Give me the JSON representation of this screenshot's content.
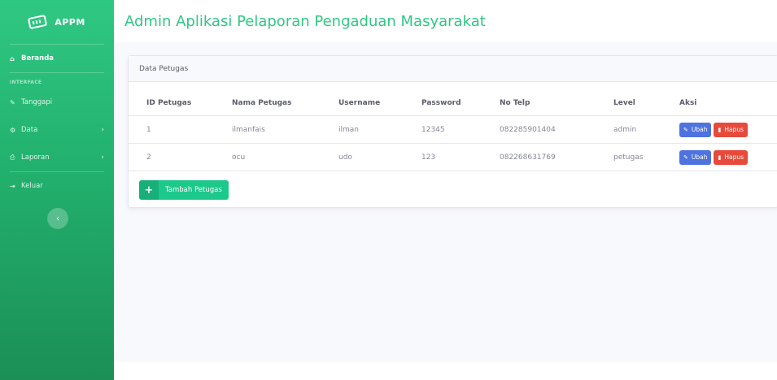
{
  "app": {
    "brand": "APPM",
    "page_title": "Admin Aplikasi Pelaporan Pengaduan Masyarakat",
    "accent_color": "#2fc883"
  },
  "sidebar": {
    "items": [
      {
        "label": "Beranda",
        "icon": "home-icon",
        "active": true
      },
      {
        "label": "Tanggapi",
        "icon": "edit-icon"
      },
      {
        "label": "Data",
        "icon": "gear-icon",
        "has_submenu": true
      },
      {
        "label": "Laporan",
        "icon": "print-icon",
        "has_submenu": true
      },
      {
        "label": "Keluar",
        "icon": "logout-icon"
      }
    ],
    "heading": "INTERFACE",
    "toggle_icon": "‹"
  },
  "card": {
    "title": "Data Petugas",
    "columns": [
      "ID Petugas",
      "Nama Petugas",
      "Username",
      "Password",
      "No Telp",
      "Level",
      "Aksi"
    ],
    "rows": [
      {
        "id": "1",
        "nama": "ilmanfais",
        "username": "ilman",
        "password": "12345",
        "telp": "082285901404",
        "level": "admin"
      },
      {
        "id": "2",
        "nama": "ocu",
        "username": "udo",
        "password": "123",
        "telp": "082268631769",
        "level": "petugas"
      }
    ],
    "edit_label": "Ubah",
    "delete_label": "Hapus",
    "add_label": "Tambah Petugas",
    "add_icon": "+"
  },
  "icons": {
    "home": "🏠",
    "edit": "✎",
    "gear": "⚙",
    "print": "⎙",
    "logout": "⇥",
    "chevron": "›",
    "trash": "🗑"
  },
  "colors": {
    "edit_button": "#4e73df",
    "delete_button": "#e74a3b",
    "add_button": "#1cc88a"
  }
}
